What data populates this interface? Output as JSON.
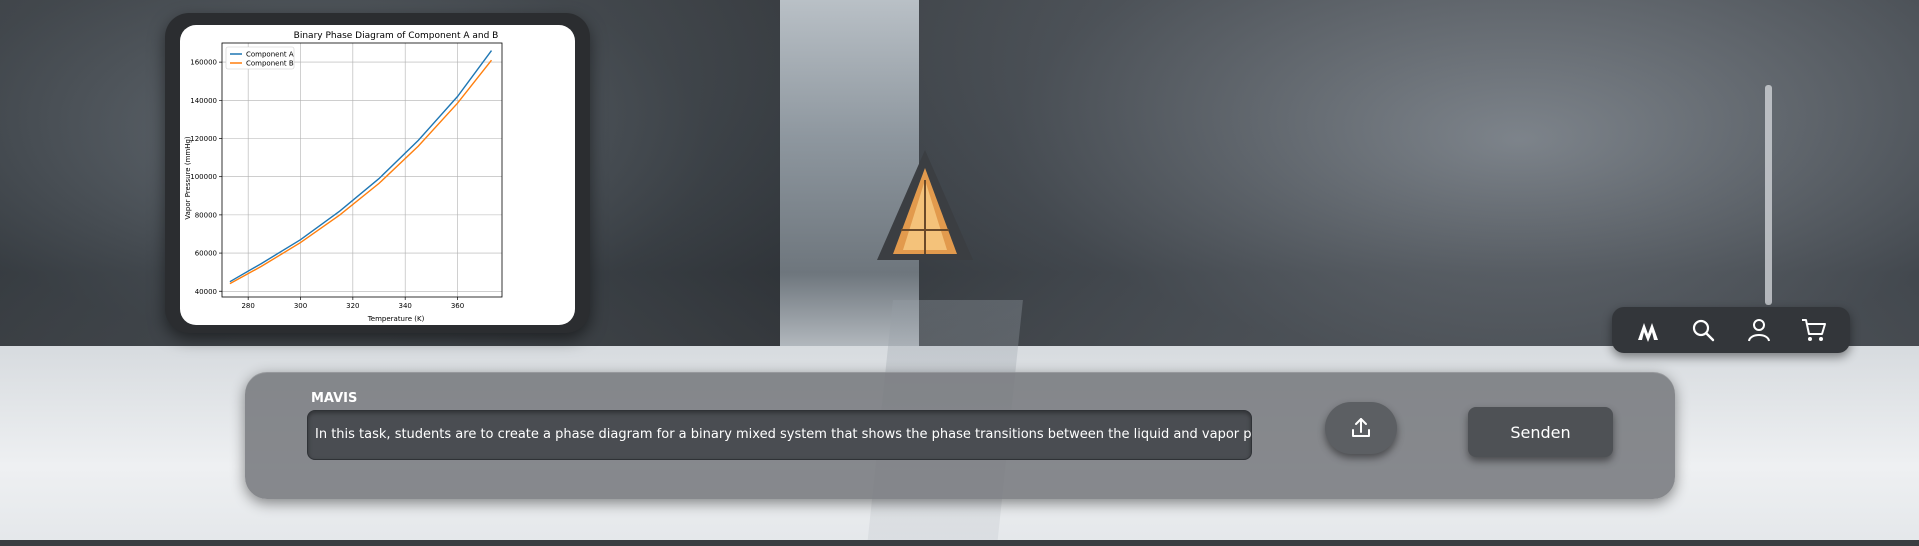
{
  "app": {
    "assistant_name": "MAVIS",
    "prompt_text": "In this task, students are to create a phase diagram for a binary mixed system that shows the phase transitions between the liquid and vapor phases. They",
    "send_label": "Senden"
  },
  "toolbar": {
    "items": [
      {
        "icon": "logo-icon"
      },
      {
        "icon": "search-icon"
      },
      {
        "icon": "user-icon"
      },
      {
        "icon": "cart-icon"
      }
    ]
  },
  "colors": {
    "panel": "#7a7c80",
    "series_a": "#1f77b4",
    "series_b": "#ff7f0e"
  },
  "chart_data": {
    "type": "line",
    "title": "Binary Phase Diagram of Component A and B",
    "xlabel": "Temperature (K)",
    "ylabel": "Vapor Pressure (mmHg)",
    "xlim": [
      270,
      377
    ],
    "ylim": [
      37000,
      170000
    ],
    "xticks": [
      280,
      300,
      320,
      340,
      360
    ],
    "yticks": [
      40000,
      60000,
      80000,
      100000,
      120000,
      140000,
      160000
    ],
    "grid": true,
    "legend": "top-left",
    "series": [
      {
        "name": "Component A",
        "color": "#1f77b4",
        "x": [
          273,
          285,
          300,
          315,
          330,
          345,
          360,
          373
        ],
        "y": [
          45000,
          54500,
          67000,
          82000,
          99000,
          119000,
          142000,
          166000
        ]
      },
      {
        "name": "Component B",
        "color": "#ff7f0e",
        "x": [
          273,
          285,
          300,
          315,
          330,
          345,
          360,
          373
        ],
        "y": [
          44000,
          53000,
          65500,
          80000,
          96500,
          116000,
          138500,
          161000
        ]
      }
    ]
  }
}
